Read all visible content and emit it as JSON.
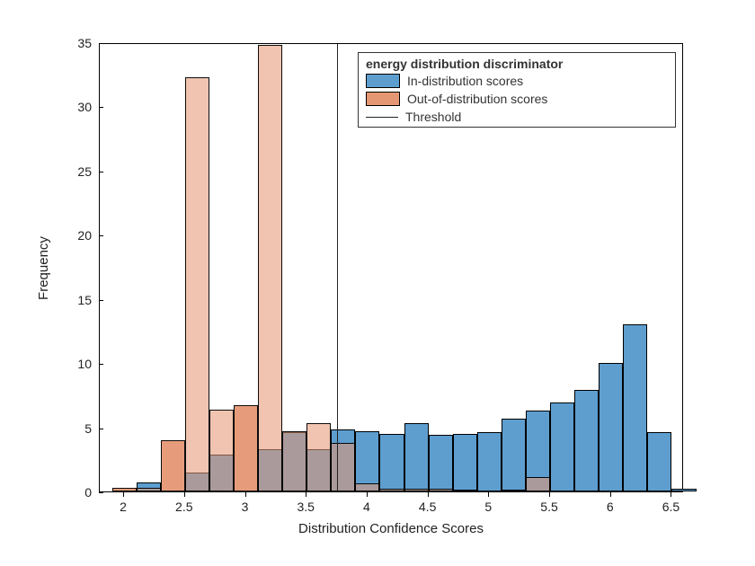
{
  "chart_data": {
    "type": "bar",
    "title": "",
    "xlabel": "Distribution Confidence Scores",
    "ylabel": "Frequency",
    "xlim": [
      1.8,
      6.6
    ],
    "ylim": [
      0,
      35
    ],
    "x_ticks": [
      2,
      2.5,
      3,
      3.5,
      4,
      4.5,
      5,
      5.5,
      6,
      6.5
    ],
    "y_ticks": [
      0,
      5,
      10,
      15,
      20,
      25,
      30,
      35
    ],
    "bin_centers": [
      2.0,
      2.2,
      2.4,
      2.6,
      2.8,
      3.0,
      3.2,
      3.4,
      3.6,
      3.8,
      4.0,
      4.2,
      4.4,
      4.6,
      4.8,
      5.0,
      5.2,
      5.4,
      5.6,
      5.8,
      6.0,
      6.2,
      6.4,
      6.6
    ],
    "bin_width": 0.2,
    "series": [
      {
        "name": "In-distribution scores",
        "color": "#5e9ecf",
        "values": [
          0,
          0.7,
          0,
          1.5,
          2.9,
          0,
          3.3,
          4.6,
          3.3,
          4.8,
          4.7,
          4.5,
          5.3,
          4.4,
          4.5,
          4.6,
          5.7,
          6.3,
          6.9,
          7.9,
          10.0,
          13.0,
          4.6,
          0.2
        ]
      },
      {
        "name": "Out-of-distribution scores",
        "color": "#e59773",
        "values": [
          0.3,
          0.3,
          4.0,
          32.3,
          6.4,
          6.7,
          34.8,
          4.7,
          5.3,
          3.8,
          0.6,
          0.2,
          0.2,
          0.2,
          0.1,
          0,
          0.1,
          1.1,
          0,
          0,
          0,
          0,
          0,
          0
        ]
      }
    ],
    "threshold": 3.75,
    "legend": {
      "title": "energy distribution discriminator",
      "entries": [
        {
          "label": "In-distribution scores",
          "kind": "swatch",
          "color": "#5e9ecf"
        },
        {
          "label": "Out-of-distribution scores",
          "kind": "swatch",
          "color": "#e59773"
        },
        {
          "label": "Threshold",
          "kind": "line",
          "color": "#222222"
        }
      ]
    }
  }
}
